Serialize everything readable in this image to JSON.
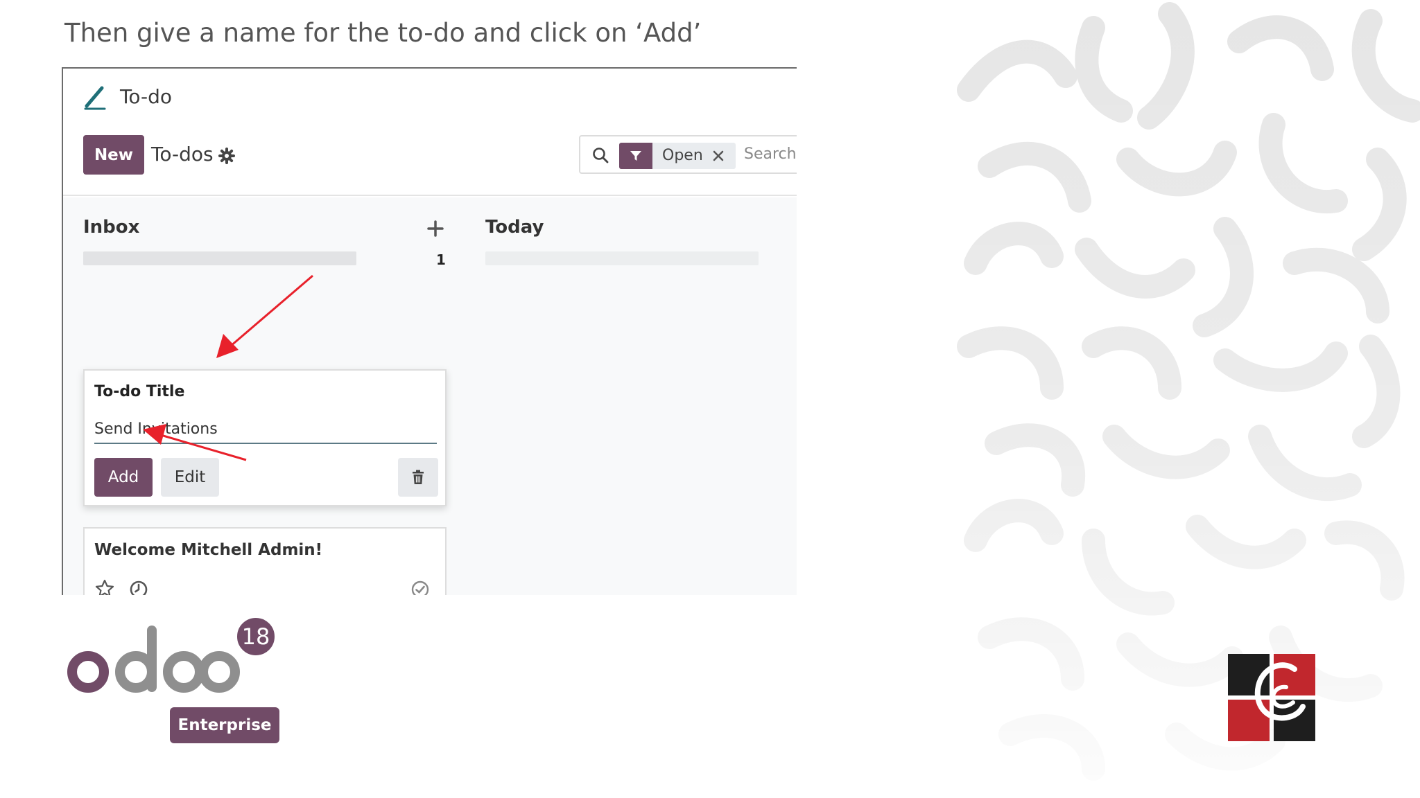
{
  "slide": {
    "title": "Then give a name for the to-do and click on ‘Add’"
  },
  "app": {
    "name": "To-do",
    "icon": "pencil-icon"
  },
  "control_panel": {
    "new_label": "New",
    "breadcrumb": "To-dos",
    "settings_icon": "gear-icon",
    "search": {
      "icon": "search-icon",
      "facet_icon": "filter-icon",
      "facet_label": "Open",
      "facet_remove_icon": "close-icon",
      "placeholder": "Search"
    }
  },
  "kanban": {
    "columns": [
      {
        "title": "Inbox",
        "count": "1",
        "add_icon": "plus-icon"
      },
      {
        "title": "Today"
      }
    ],
    "quick_create": {
      "field_label": "To-do Title",
      "field_value": "Send Invitations",
      "add_label": "Add",
      "edit_label": "Edit",
      "delete_icon": "trash-icon"
    },
    "cards": [
      {
        "title": "Welcome Mitchell Admin!",
        "icons": [
          "star-icon",
          "clock-icon",
          "check-circle-icon"
        ]
      }
    ]
  },
  "branding": {
    "odoo_version": "18",
    "odoo_edition": "Enterprise"
  },
  "colors": {
    "odoo_purple": "#714b67",
    "arrow_red": "#e8212b",
    "logo_red": "#c1272d",
    "logo_dark": "#1e1e1e"
  }
}
